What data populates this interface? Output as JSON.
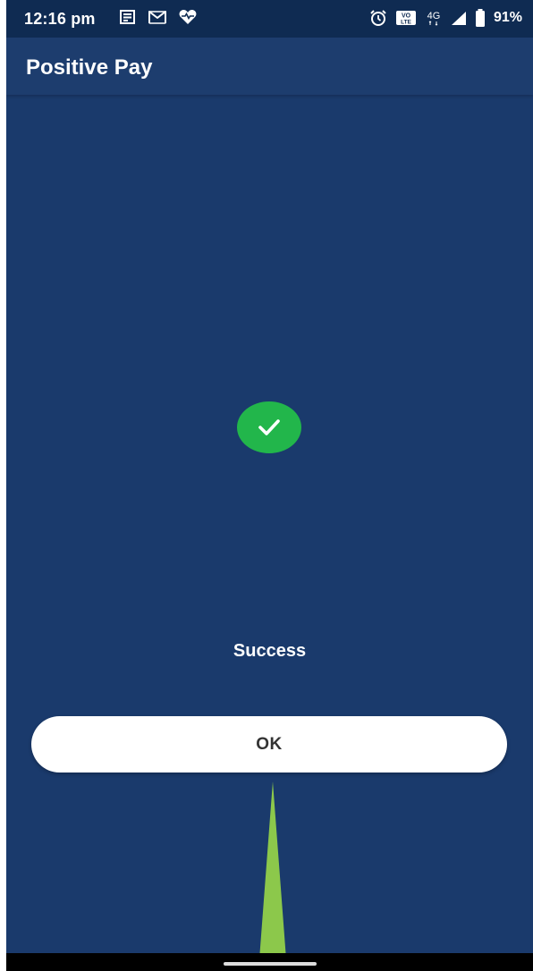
{
  "status_bar": {
    "time": "12:16 pm",
    "left_icons": [
      "news-icon",
      "gmail-icon",
      "health-heart-icon"
    ],
    "right_icons": [
      "alarm-icon",
      "volte-icon",
      "4g-icon",
      "signal-icon",
      "battery-icon"
    ],
    "battery_percent": "91%"
  },
  "app_bar": {
    "title": "Positive Pay"
  },
  "main": {
    "status_icon": "check-circle-icon",
    "status_text": "Success",
    "ok_label": "OK"
  },
  "colors": {
    "background": "#1a3a6c",
    "status_bar": "#0f2b52",
    "success_green": "#22b64b",
    "button_bg": "#ffffff",
    "pointer_green": "#8cc84b"
  }
}
